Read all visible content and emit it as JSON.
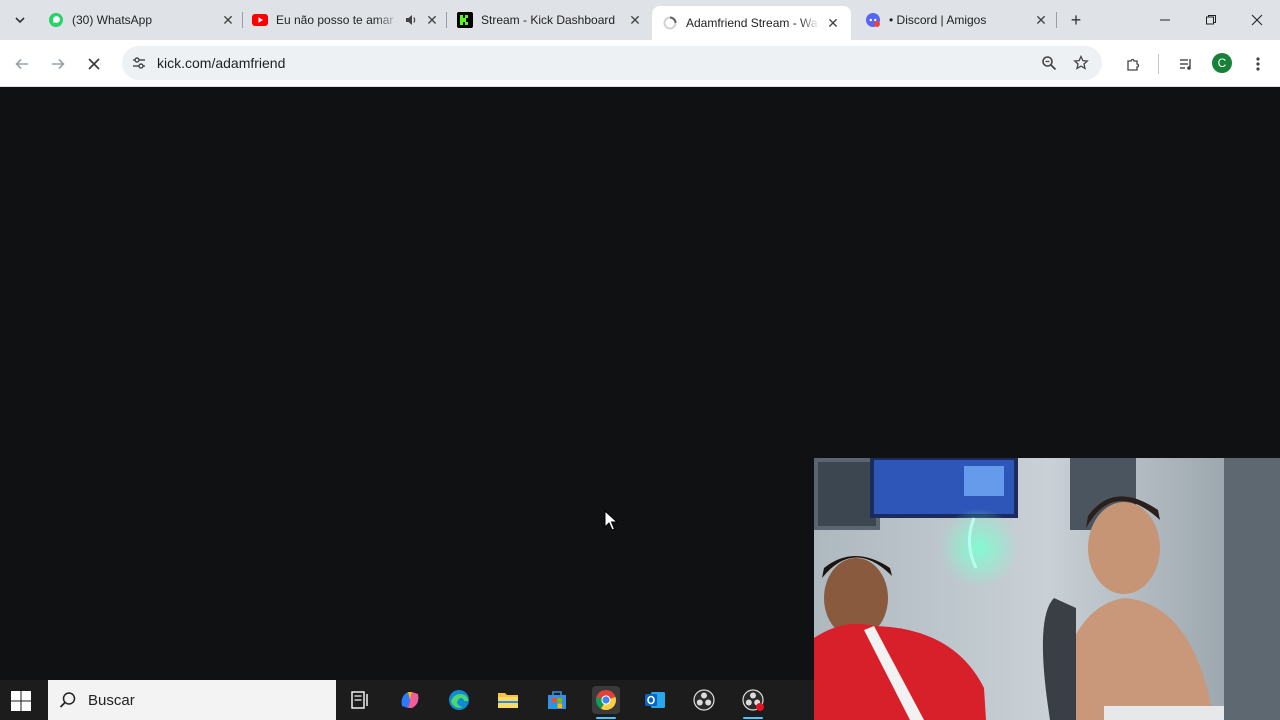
{
  "tabs": [
    {
      "title": "(30) WhatsApp",
      "icon": "whatsapp-icon",
      "color": "#25d366"
    },
    {
      "title": "Eu não posso te amar",
      "icon": "youtube-icon",
      "color": "#ff0000"
    },
    {
      "title": "Stream - Kick Dashboard",
      "icon": "kick-icon",
      "color": "#53fc18"
    },
    {
      "title": "Adamfriend Stream - Wa",
      "icon": "loading-icon",
      "color": "#5f6368"
    },
    {
      "title": "• Discord | Amigos",
      "icon": "discord-icon",
      "color": "#5865f2"
    }
  ],
  "address": {
    "url": "kick.com/adamfriend"
  },
  "profile": {
    "initial": "C"
  },
  "taskbar": {
    "search_placeholder": "Buscar"
  }
}
